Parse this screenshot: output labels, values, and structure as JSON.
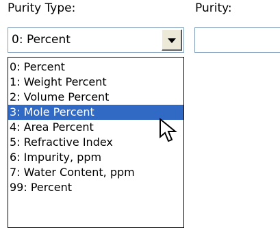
{
  "labels": {
    "purity_type": "Purity Type:",
    "purity": "Purity:"
  },
  "purity_type_combo": {
    "selected_value": "0: Percent",
    "open": true,
    "highlighted_index": 3,
    "options": [
      "0: Percent",
      "1: Weight Percent",
      "2: Volume Percent",
      "3: Mole Percent",
      "4: Area Percent",
      "5: Refractive Index",
      "6: Impurity, ppm",
      "7: Water Content, ppm",
      "99: Percent"
    ]
  },
  "purity_field": {
    "value": ""
  },
  "colors": {
    "highlight": "#316ac5",
    "field_border": "#7f9db9",
    "button_face": "#ece9d8"
  },
  "icons": {
    "dropdown_arrow": "chevron-down-icon",
    "cursor": "mouse-pointer-icon"
  }
}
